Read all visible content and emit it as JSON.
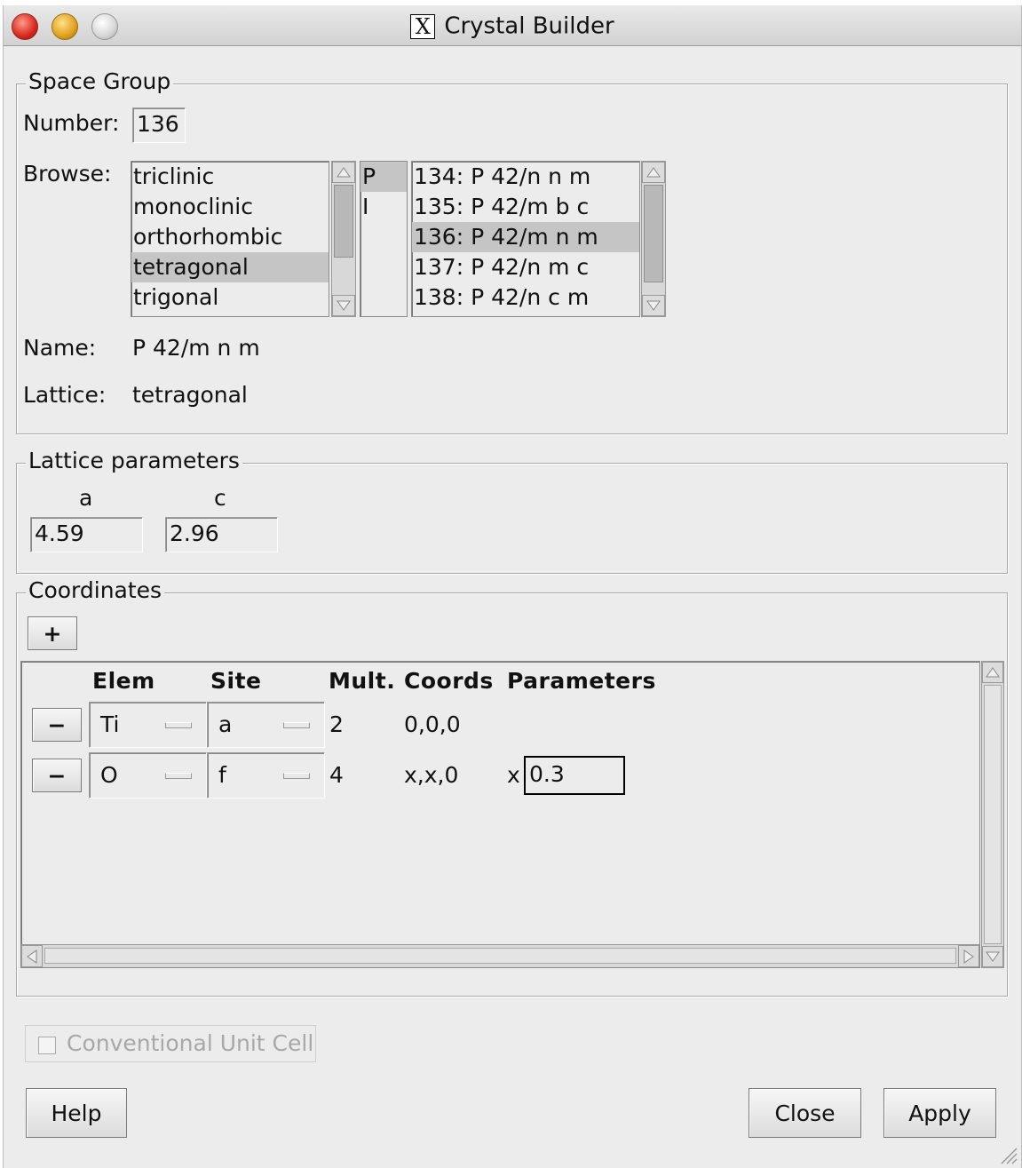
{
  "window": {
    "title": "Crystal Builder"
  },
  "space_group": {
    "legend": "Space Group",
    "number_label": "Number:",
    "number_value": "136",
    "browse_label": "Browse:",
    "systems": [
      "triclinic",
      "monoclinic",
      "orthorhombic",
      "tetragonal",
      "trigonal"
    ],
    "selected_system": "tetragonal",
    "centering": [
      "P",
      "I"
    ],
    "selected_centering": "P",
    "groups": [
      "134: P 42/n n m",
      "135: P 42/m b c",
      "136: P 42/m n m",
      "137: P 42/n m c",
      "138: P 42/n c m"
    ],
    "selected_group": "136: P 42/m n m",
    "name_label": "Name:",
    "name_value": "P 42/m n m",
    "lattice_label": "Lattice:",
    "lattice_value": "tetragonal"
  },
  "lattice_parameters": {
    "legend": "Lattice parameters",
    "a_label": "a",
    "a_value": "4.59",
    "c_label": "c",
    "c_value": "2.96"
  },
  "coordinates": {
    "legend": "Coordinates",
    "add_label": "+",
    "headers": {
      "elem": "Elem",
      "site": "Site",
      "mult": "Mult.",
      "coords": "Coords",
      "parameters": "Parameters"
    },
    "rows": [
      {
        "remove": "−",
        "elem": "Ti",
        "site": "a",
        "mult": "2",
        "coords": "0,0,0",
        "param_label": "",
        "param_value": ""
      },
      {
        "remove": "−",
        "elem": "O",
        "site": "f",
        "mult": "4",
        "coords": "x,x,0",
        "param_label": "x",
        "param_value": "0.3"
      }
    ]
  },
  "conventional_cell": {
    "label": "Conventional Unit Cell",
    "checked": false,
    "enabled": false
  },
  "buttons": {
    "help": "Help",
    "close": "Close",
    "apply": "Apply"
  }
}
